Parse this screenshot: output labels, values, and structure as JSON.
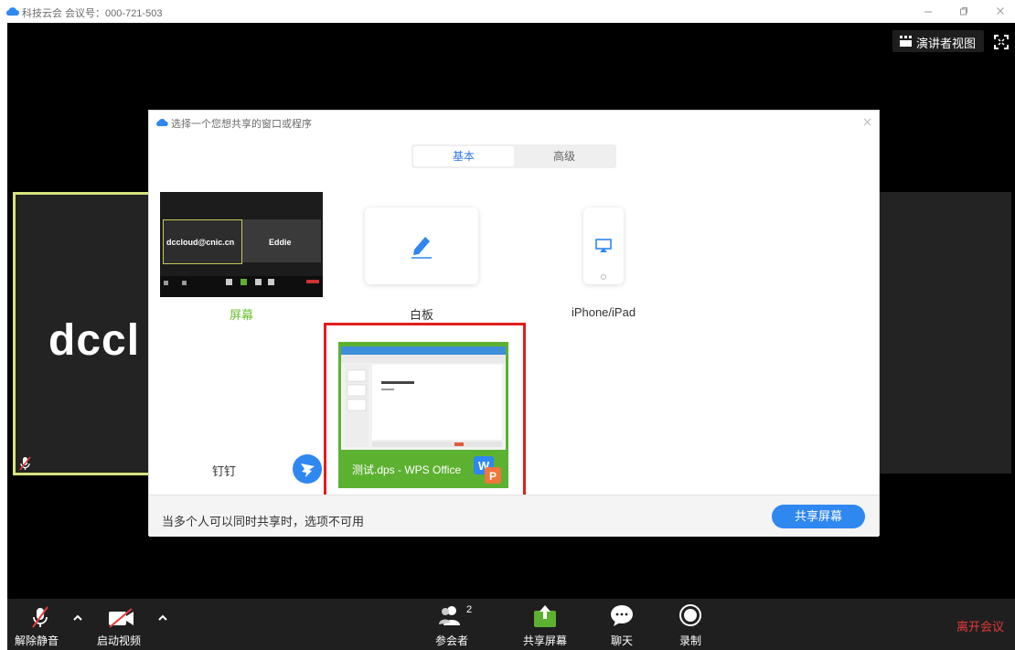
{
  "window": {
    "title": "科技云会 会议号：000-721-503"
  },
  "stage": {
    "speaker_view_label": "演讲者视图",
    "participant_tile_name": "dccl"
  },
  "dialog": {
    "title": "选择一个您想共享的窗口或程序",
    "tabs": [
      {
        "label": "基本",
        "active": true
      },
      {
        "label": "高级",
        "active": false
      }
    ],
    "options": {
      "screen": {
        "label": "屏幕",
        "thumb_names": [
          "dccloud@cnic.cn",
          "Eddie"
        ]
      },
      "whiteboard": {
        "label": "白板"
      },
      "iphone": {
        "label": "iPhone/iPad"
      },
      "dingtalk": {
        "label": "钉钉"
      },
      "wps": {
        "label": "测试.dps - WPS Office",
        "doc_heading": "单击此处添加标题"
      }
    },
    "footer_note": "当多个人可以同时共享时，选项不可用",
    "share_button": "共享屏幕"
  },
  "toolbar": {
    "unmute": "解除静音",
    "start_video": "启动视频",
    "participants": "参会者",
    "participant_count": "2",
    "share_screen": "共享屏幕",
    "chat": "聊天",
    "record": "录制",
    "leave": "离开会议"
  },
  "colors": {
    "accent_blue": "#2f87f0",
    "share_green": "#5db131",
    "highlight_red": "#e51c1c",
    "leave_red": "#e53a3a",
    "tile_border": "#d7e27e"
  }
}
